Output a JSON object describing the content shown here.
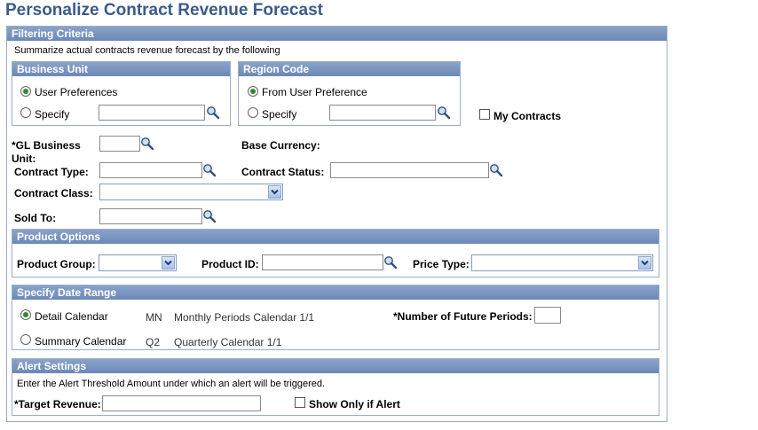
{
  "page": {
    "title": "Personalize Contract Revenue Forecast"
  },
  "filtering": {
    "header": "Filtering Criteria",
    "description": "Summarize actual contracts revenue forecast by the following",
    "business_unit": {
      "header": "Business Unit",
      "option_user_pref": "User Preferences",
      "option_specify": "Specify",
      "specify_value": ""
    },
    "region_code": {
      "header": "Region Code",
      "option_user_pref": "From User Preference",
      "option_specify": "Specify",
      "specify_value": ""
    },
    "my_contracts_label": "My Contracts",
    "gl_business_unit_label": "*GL Business Unit:",
    "gl_business_unit_value": "",
    "base_currency_label": "Base Currency:",
    "contract_type_label": "Contract Type:",
    "contract_type_value": "",
    "contract_status_label": "Contract Status:",
    "contract_status_value": "",
    "contract_class_label": "Contract Class:",
    "contract_class_value": "",
    "sold_to_label": "Sold To:",
    "sold_to_value": ""
  },
  "product_options": {
    "header": "Product Options",
    "product_group_label": "Product Group:",
    "product_group_value": "",
    "product_id_label": "Product ID:",
    "product_id_value": "",
    "price_type_label": "Price Type:",
    "price_type_value": ""
  },
  "date_range": {
    "header": "Specify Date Range",
    "detail_label": "Detail Calendar",
    "detail_code": "MN",
    "detail_desc": "Monthly Periods Calendar 1/1",
    "summary_label": "Summary Calendar",
    "summary_code": "Q2",
    "summary_desc": "Quarterly Calendar 1/1",
    "future_periods_label": "*Number of Future Periods:",
    "future_periods_value": ""
  },
  "alert": {
    "header": "Alert Settings",
    "description": "Enter the Alert Threshold Amount under which an alert will be triggered.",
    "target_revenue_label": "*Target Revenue:",
    "target_revenue_value": "",
    "show_only_label": "Show Only if Alert"
  }
}
